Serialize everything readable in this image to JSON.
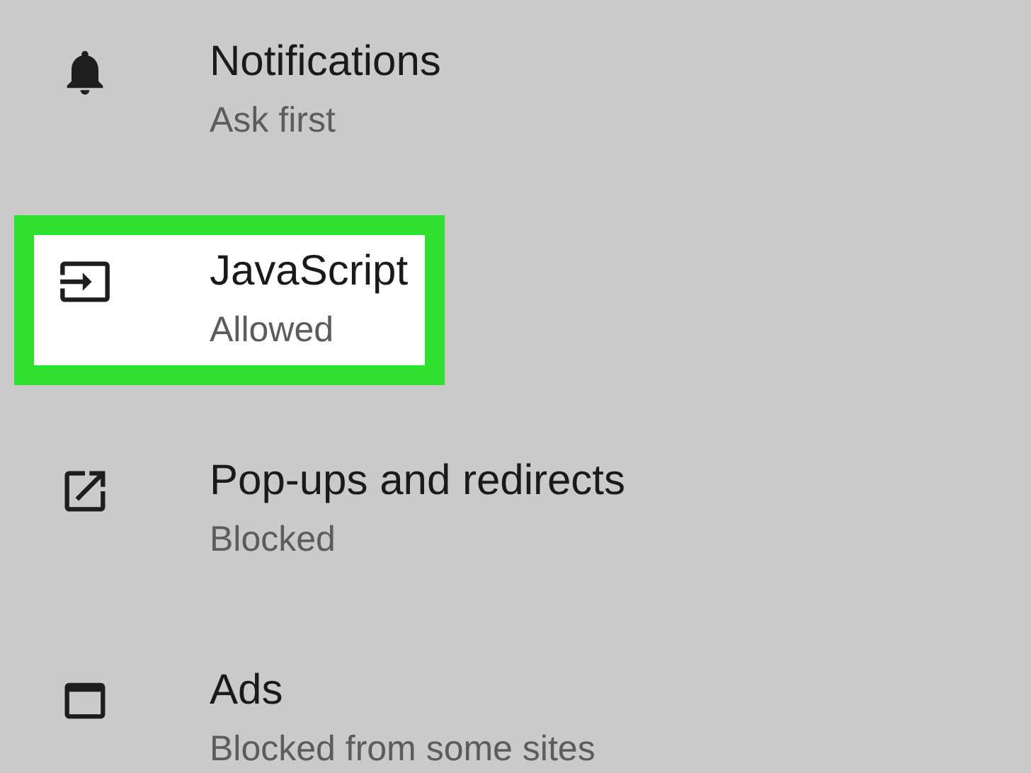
{
  "settings": {
    "items": [
      {
        "title": "Notifications",
        "subtitle": "Ask first",
        "highlighted": false
      },
      {
        "title": "JavaScript",
        "subtitle": "Allowed",
        "highlighted": true
      },
      {
        "title": "Pop-ups and redirects",
        "subtitle": "Blocked",
        "highlighted": false
      },
      {
        "title": "Ads",
        "subtitle": "Blocked from some sites",
        "highlighted": false
      }
    ]
  }
}
